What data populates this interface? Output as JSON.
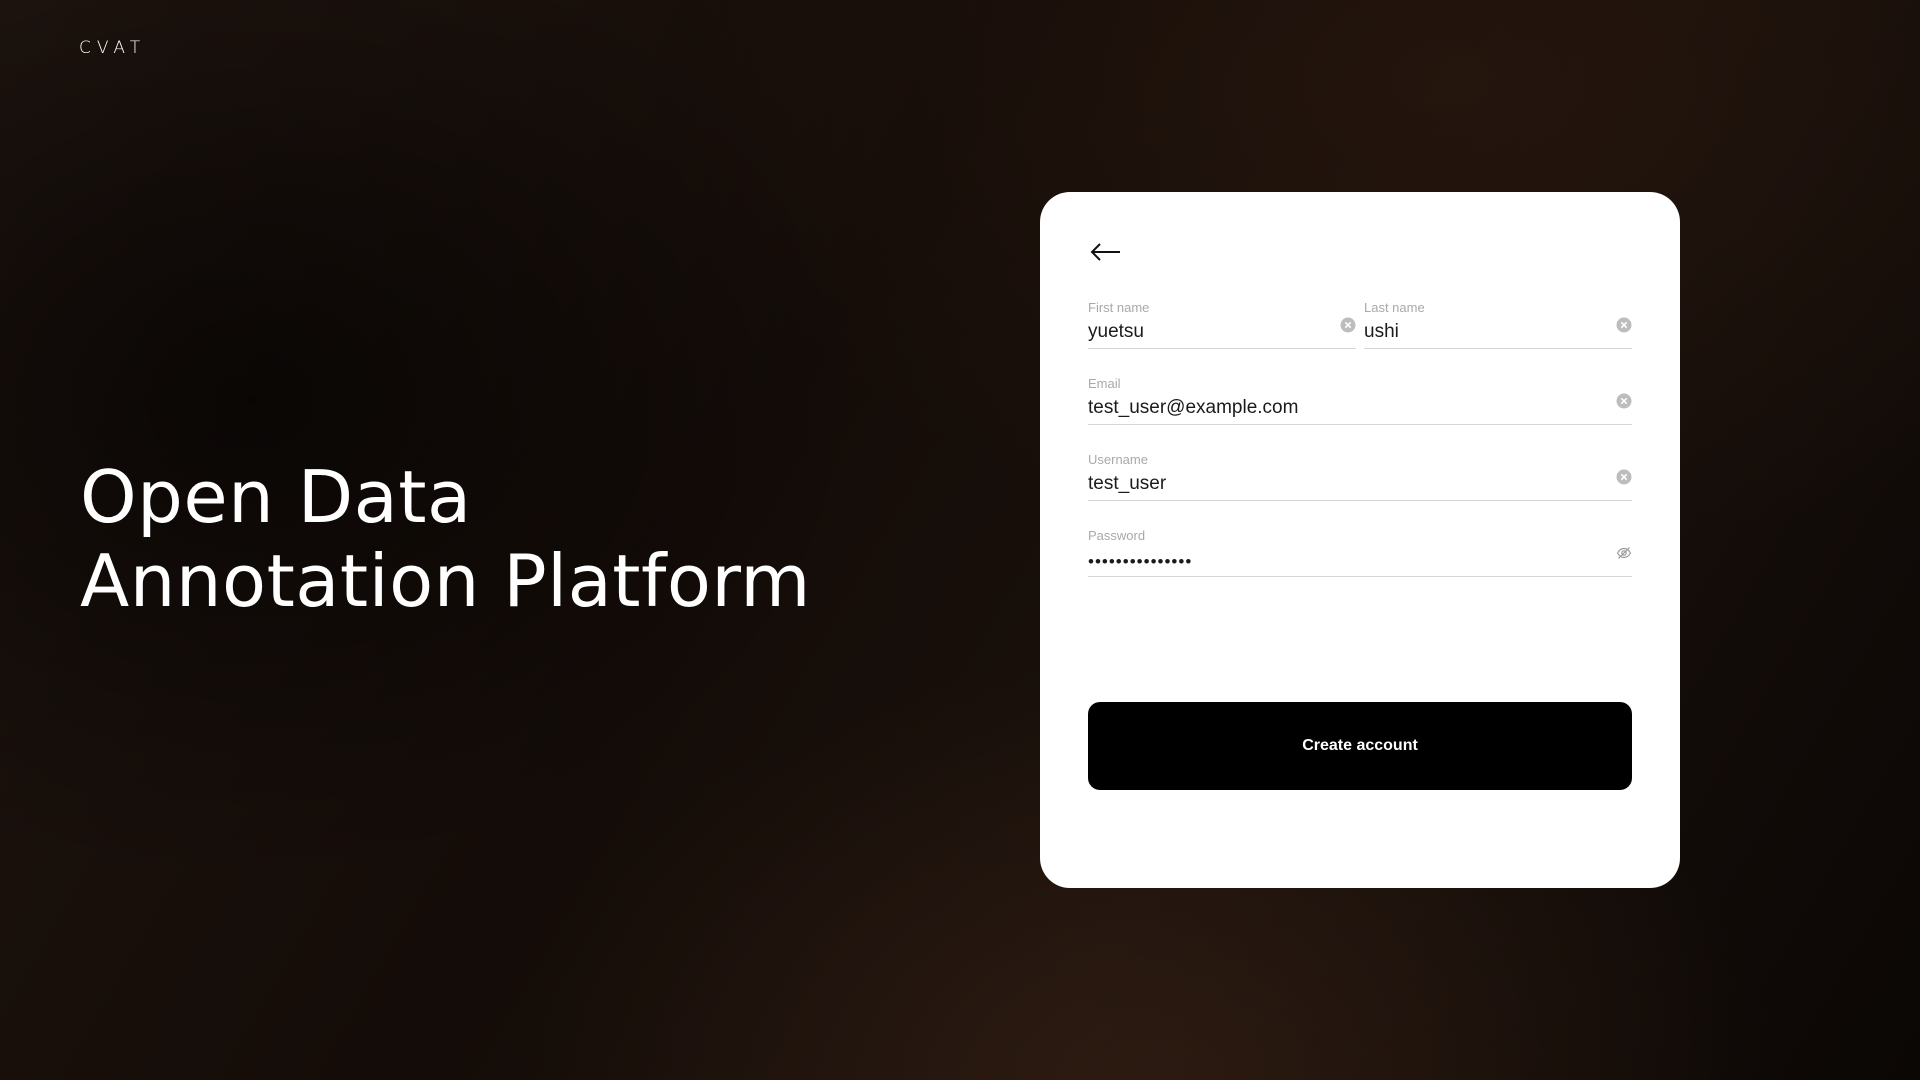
{
  "brand": {
    "logo_text": "CVAT"
  },
  "hero": {
    "line1": "Open Data",
    "line2": "Annotation Platform"
  },
  "form": {
    "first_name": {
      "label": "First name",
      "value": "yuetsu"
    },
    "last_name": {
      "label": "Last name",
      "value": "ushi"
    },
    "email": {
      "label": "Email",
      "value": "test_user@example.com"
    },
    "username": {
      "label": "Username",
      "value": "test_user"
    },
    "password": {
      "label": "Password",
      "value": "•••••••••••••••"
    },
    "submit_label": "Create account"
  },
  "icons": {
    "back": "arrow-left-icon",
    "clear": "close-circle-icon",
    "password_visibility": "eye-invisible-icon"
  },
  "colors": {
    "button_bg": "#000000",
    "card_bg": "#ffffff",
    "label": "#a9a9a9"
  }
}
